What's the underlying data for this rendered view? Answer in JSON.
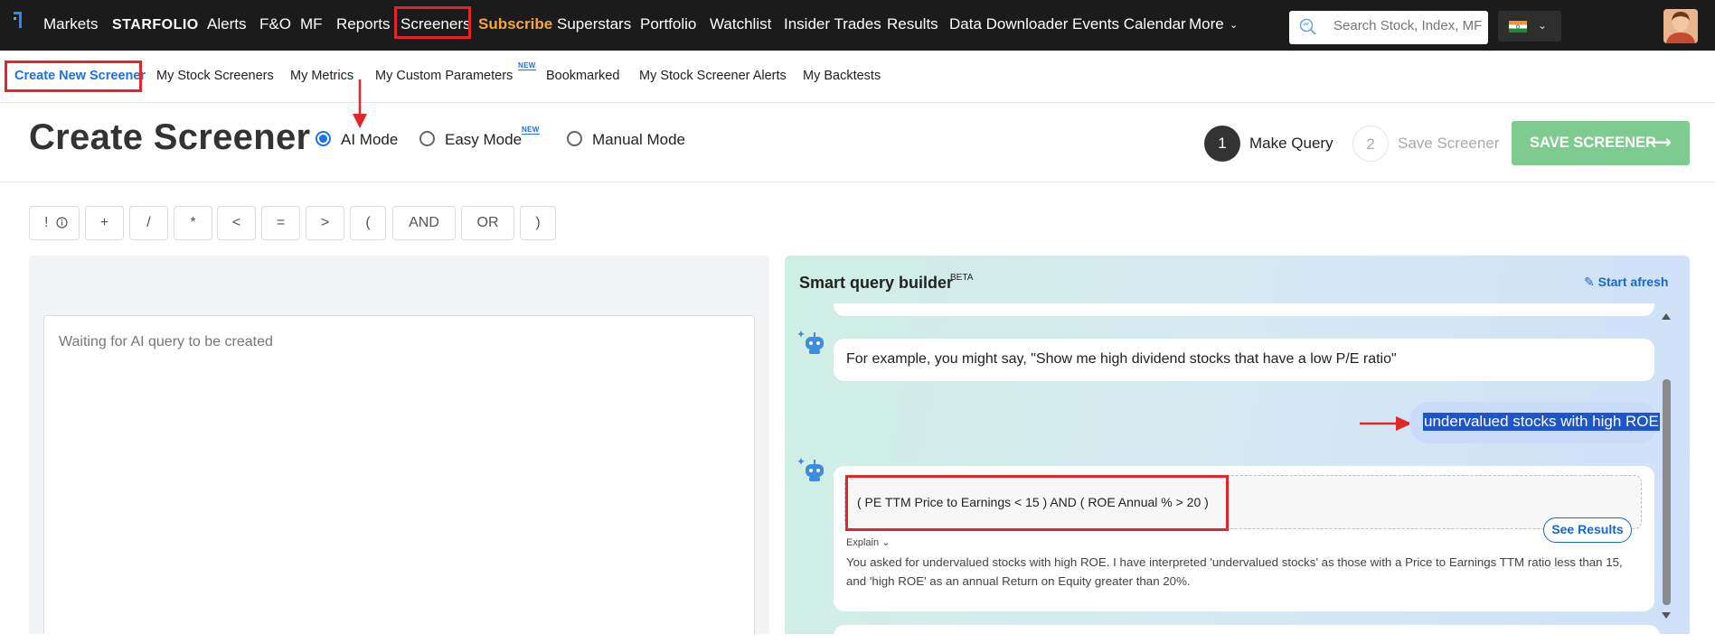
{
  "topnav": {
    "items": [
      {
        "label": "Markets"
      },
      {
        "label": "STARFOLIO"
      },
      {
        "label": "Alerts"
      },
      {
        "label": "F&O"
      },
      {
        "label": "MF"
      },
      {
        "label": "Reports"
      },
      {
        "label": "Screeners"
      },
      {
        "label": "Subscribe"
      },
      {
        "label": "Superstars"
      },
      {
        "label": "Portfolio"
      },
      {
        "label": "Watchlist"
      },
      {
        "label": "Insider Trades"
      },
      {
        "label": "Results"
      },
      {
        "label": "Data Downloader"
      },
      {
        "label": "Events Calendar"
      },
      {
        "label": "More"
      }
    ],
    "search_placeholder": "Search Stock, Index, MF",
    "subscribe_color": "#f7a43a"
  },
  "subnav": {
    "items": [
      {
        "label": "Create New Screener"
      },
      {
        "label": "My Stock Screeners"
      },
      {
        "label": "My Metrics"
      },
      {
        "label": "My Custom Parameters"
      },
      {
        "label": "Bookmarked"
      },
      {
        "label": "My Stock Screener Alerts"
      },
      {
        "label": "My Backtests"
      }
    ],
    "new_badge": "NEW"
  },
  "header": {
    "title": "Create Screener",
    "modes": [
      {
        "label": "AI Mode",
        "selected": true
      },
      {
        "label": "Easy Mode",
        "selected": false,
        "badge": "NEW"
      },
      {
        "label": "Manual Mode",
        "selected": false
      }
    ],
    "steps": [
      {
        "num": "1",
        "label": "Make Query",
        "active": true
      },
      {
        "num": "2",
        "label": "Save Screener",
        "active": false
      }
    ],
    "save_button": "SAVE SCREENER",
    "save_button_color": "#7ecb8f"
  },
  "operators": [
    "!",
    "+",
    "/",
    "*",
    "<",
    "=",
    ">",
    "(",
    "AND",
    "OR",
    ")"
  ],
  "query_editor": {
    "placeholder": "Waiting for AI query to be created"
  },
  "smart_query": {
    "title": "Smart query builder",
    "beta": "BETA",
    "start_afresh": "Start afresh",
    "bot_message": "For example, you might say, \"Show me high dividend stocks that have a low P/E ratio\"",
    "user_message": "undervalued stocks with high ROE",
    "query_result": "( PE TTM Price to Earnings < 15 ) AND ( ROE Annual % > 20 )",
    "see_results": "See Results",
    "explain_label": "Explain",
    "explain_text": "You asked for undervalued stocks with high ROE. I have interpreted 'undervalued stocks' as those with a Price to Earnings TTM ratio less than 15, and 'high ROE' as an annual Return on Equity greater than 20%."
  },
  "annotation_color": "#e0262a"
}
